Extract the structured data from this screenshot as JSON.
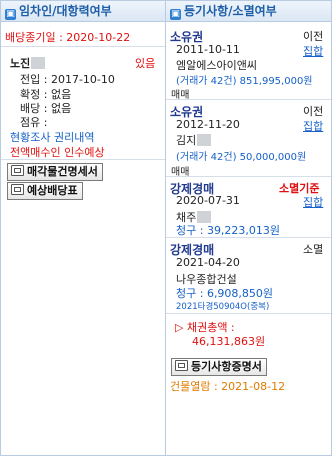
{
  "left": {
    "header": "임차인/대항력여부",
    "dividend_deadline": "배당종기일 : 2020-10-22",
    "tenant": {
      "name": "노진",
      "status": "있음",
      "rows": [
        {
          "label": "전입",
          "value": "2017-10-10"
        },
        {
          "label": "확정",
          "value": "없음"
        },
        {
          "label": "배당",
          "value": "없음"
        },
        {
          "label": "점유",
          "value": ""
        }
      ]
    },
    "survey_link": "현황조사 권리내역",
    "takeover_note": "전액매수인 인수예상",
    "buttons": {
      "statement": "매각물건명세서",
      "dividend_table": "예상배당표"
    }
  },
  "right": {
    "header": "등기사항/소멸여부",
    "entries": [
      {
        "type": "소유권",
        "status": "이전",
        "action": "집합",
        "date": "2011-10-11",
        "holder": "엠알에스아이앤씨",
        "detail": "(거래가 42건) 851,995,000원",
        "cause": "매매"
      },
      {
        "type": "소유권",
        "status": "이전",
        "action": "집합",
        "date": "2012-11-20",
        "holder": "김지",
        "detail": "(거래가 42건) 50,000,000원",
        "cause": "매매"
      },
      {
        "type": "강제경매",
        "status": "소멸기준",
        "action": "집합",
        "date": "2020-07-31",
        "holder": "채주",
        "detail": "청구 : 39,223,013원"
      },
      {
        "type": "강제경매",
        "status": "소멸",
        "date": "2021-04-20",
        "holder": "나우종합건설",
        "detail": "청구 : 6,908,850원",
        "case": "2021타경50904O(중복)"
      }
    ],
    "total_label": "▷ 채권총액 :",
    "total_amount": "46,131,863원",
    "button": "등기사항증명서",
    "view_date": "건물열람 : 2021-08-12"
  }
}
